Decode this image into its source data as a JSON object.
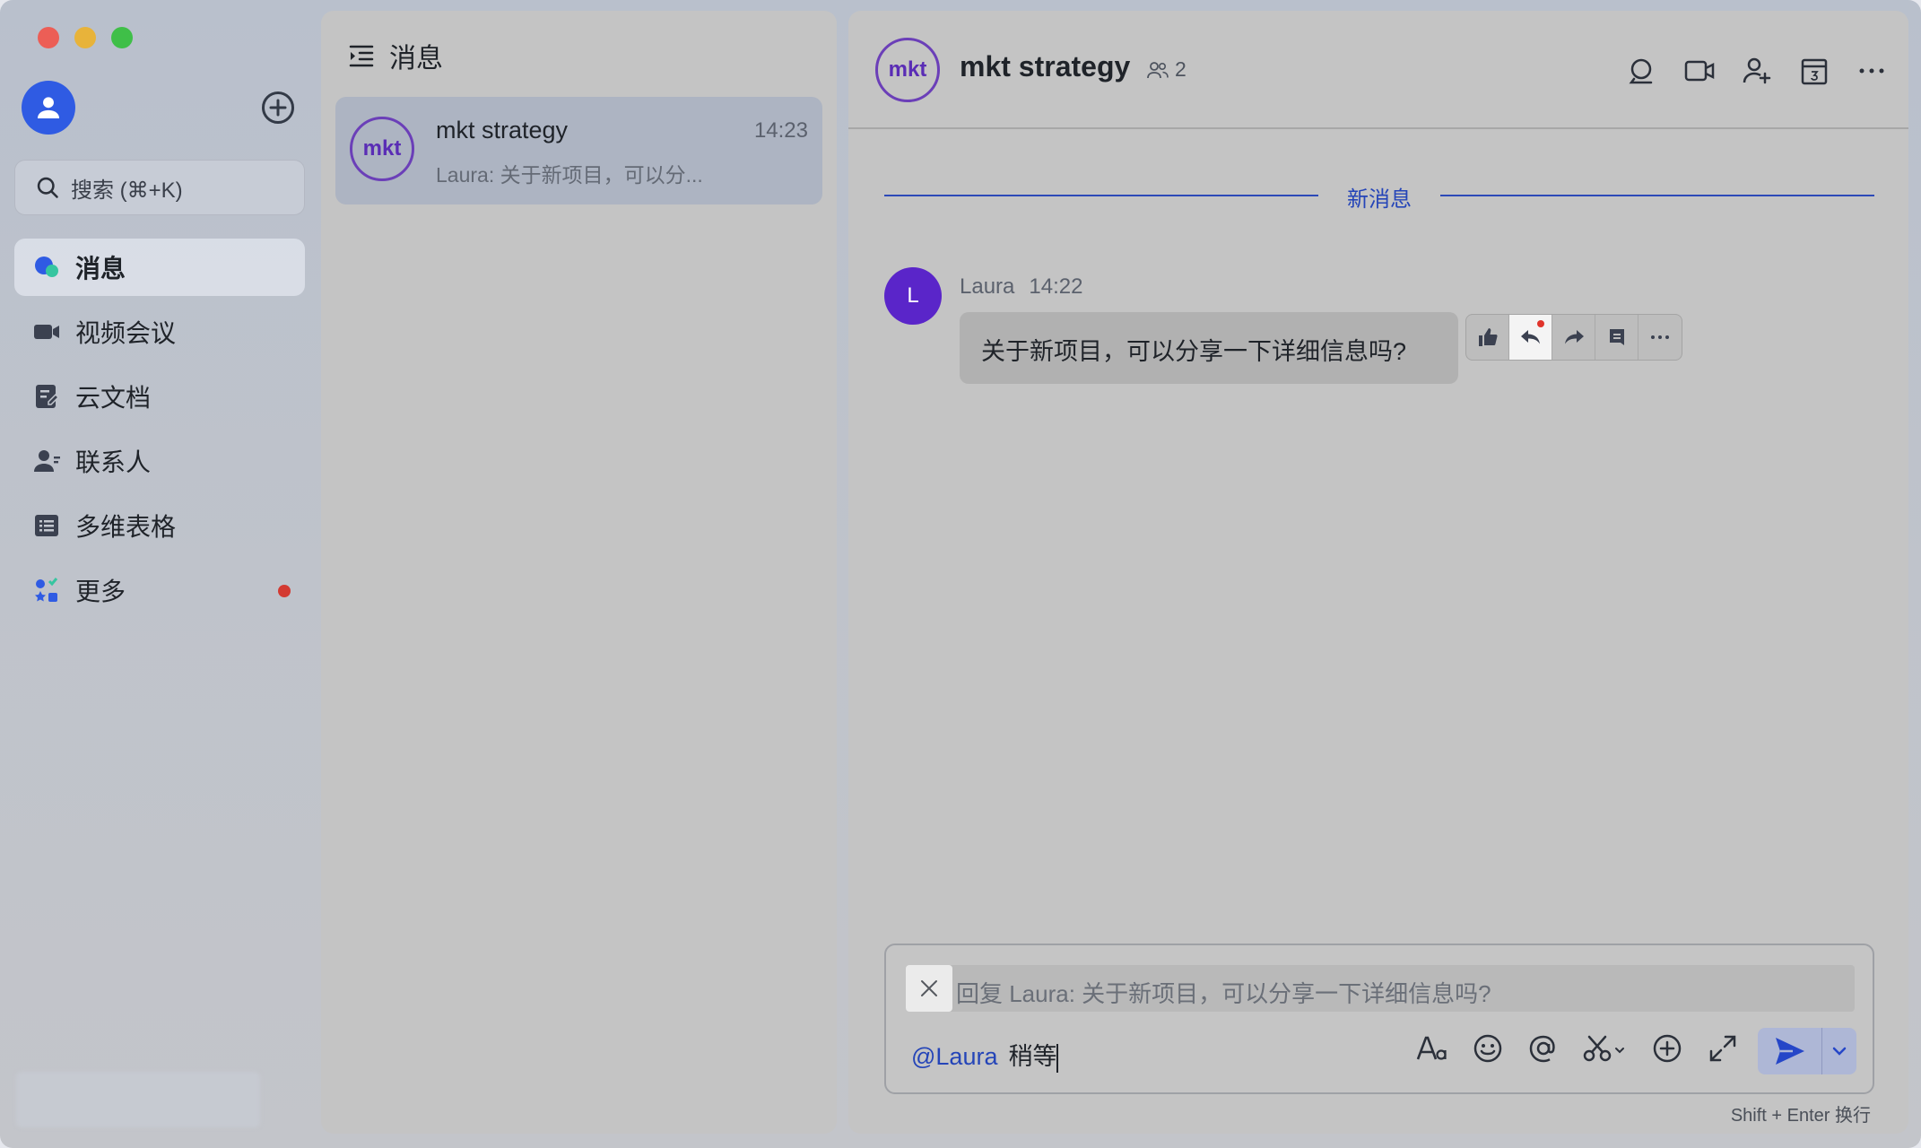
{
  "sidebar": {
    "search_placeholder": "搜索 (⌘+K)",
    "items": [
      {
        "label": "消息",
        "icon": "messages-icon",
        "active": true
      },
      {
        "label": "视频会议",
        "icon": "video-meeting-icon"
      },
      {
        "label": "云文档",
        "icon": "cloud-docs-icon"
      },
      {
        "label": "联系人",
        "icon": "contacts-icon"
      },
      {
        "label": "多维表格",
        "icon": "base-table-icon"
      },
      {
        "label": "更多",
        "icon": "more-apps-icon",
        "badge": true
      }
    ]
  },
  "list": {
    "header": "消息",
    "conversation": {
      "avatar_text": "mkt",
      "title": "mkt strategy",
      "time": "14:23",
      "preview": "Laura: 关于新项目，可以分..."
    }
  },
  "chat": {
    "avatar_text": "mkt",
    "title": "mkt strategy",
    "member_count": "2",
    "divider_label": "新消息",
    "message": {
      "avatar_letter": "L",
      "sender": "Laura",
      "time": "14:22",
      "text": "关于新项目，可以分享一下详细信息吗?"
    },
    "composer": {
      "reply_text": "回复 Laura: 关于新项目，可以分享一下详细信息吗?",
      "mention": "@Laura",
      "input_text": "稍等"
    },
    "hint": "Shift + Enter 换行"
  },
  "colors": {
    "accent": "#2545b8",
    "avatar_purple": "#5a25c9",
    "badge_red": "#d33a32"
  }
}
